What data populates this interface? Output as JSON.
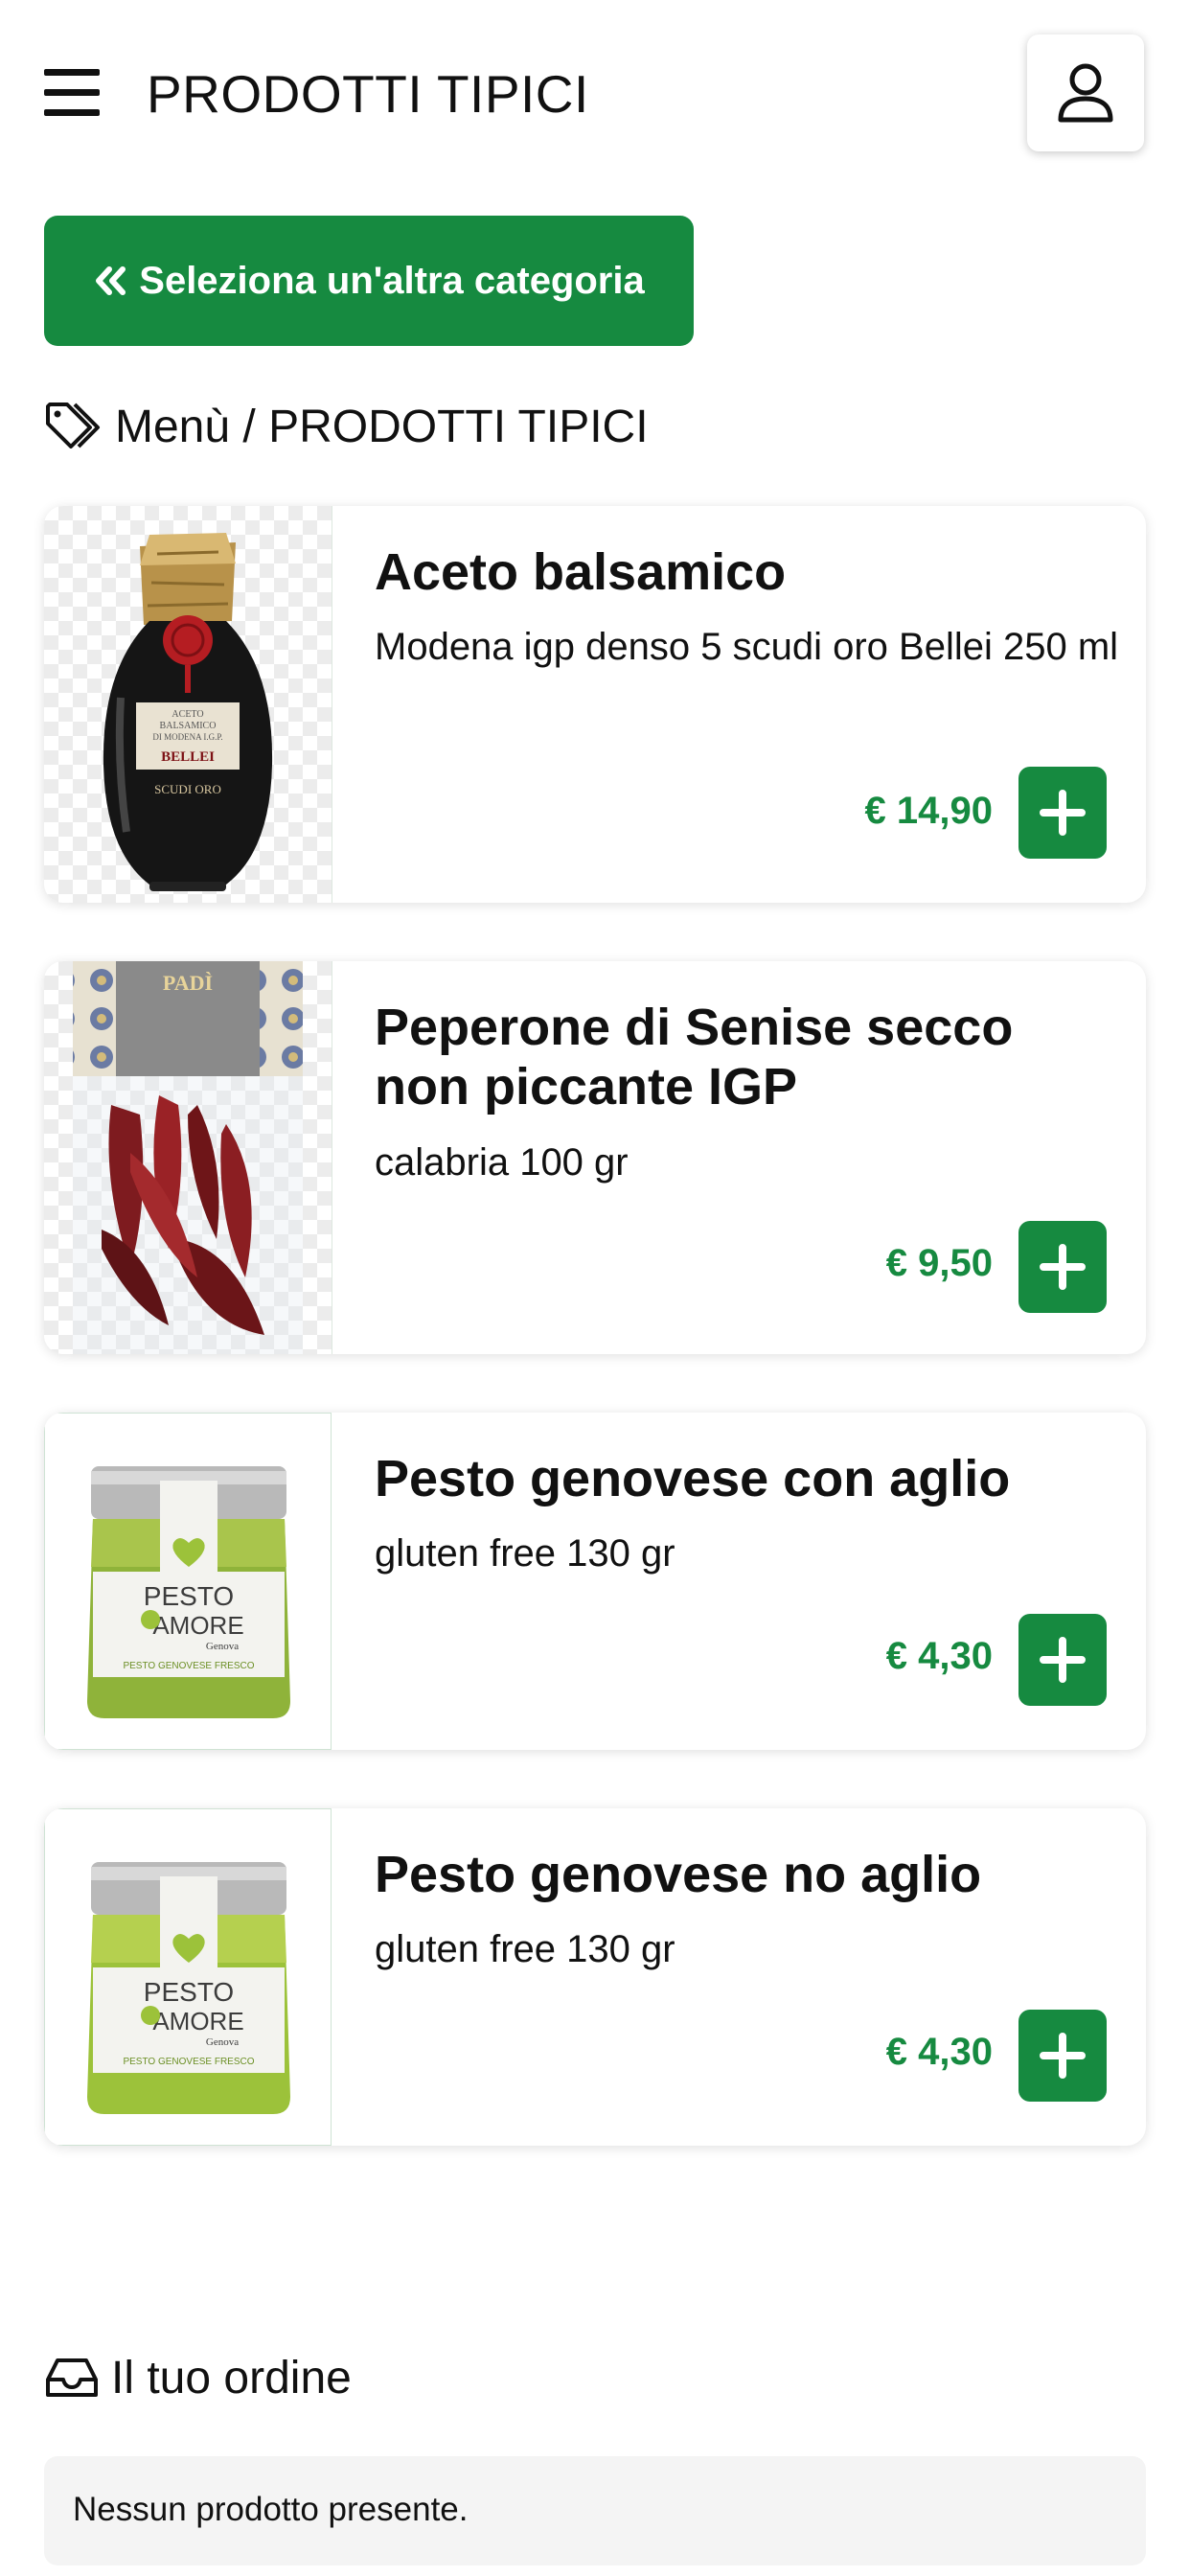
{
  "header": {
    "title": "PRODOTTI TIPICI",
    "menu_icon": "hamburger-icon",
    "user_icon": "user-icon"
  },
  "back_button": {
    "icon": "double-chevron-left-icon",
    "label": "Seleziona un'altra categoria"
  },
  "breadcrumb": {
    "icon": "tag-icon",
    "text": "Menù / PRODOTTI TIPICI"
  },
  "products": [
    {
      "name": "Aceto balsamico",
      "description": "Modena igp denso 5 scudi oro Bellei 250 ml",
      "price": "€ 14,90",
      "image_text": [
        "ACETO",
        "BALSAMICO",
        "DI MODENA I.G.P.",
        "BELLEI",
        "SCUDI ORO"
      ]
    },
    {
      "name": "Peperone di Senise secco non piccante IGP",
      "description": "calabria 100 gr",
      "price": "€ 9,50",
      "image_text": [
        "PADÌ"
      ]
    },
    {
      "name": "Pesto genovese con aglio",
      "description": "gluten free 130 gr",
      "price": "€ 4,30",
      "image_text": [
        "PESTO",
        "AMORE",
        "Genova",
        "PESTO GENOVESE FRESCO"
      ]
    },
    {
      "name": "Pesto genovese no aglio",
      "description": "gluten free 130 gr",
      "price": "€ 4,30",
      "image_text": [
        "PESTO",
        "AMORE",
        "Genova",
        "PESTO GENOVESE FRESCO"
      ]
    }
  ],
  "order": {
    "icon": "inbox-icon",
    "title": "Il tuo ordine",
    "empty_message": "Nessun prodotto presente."
  },
  "colors": {
    "accent": "#168a40",
    "price": "#168a40",
    "order_box": "#f4f4f4"
  }
}
